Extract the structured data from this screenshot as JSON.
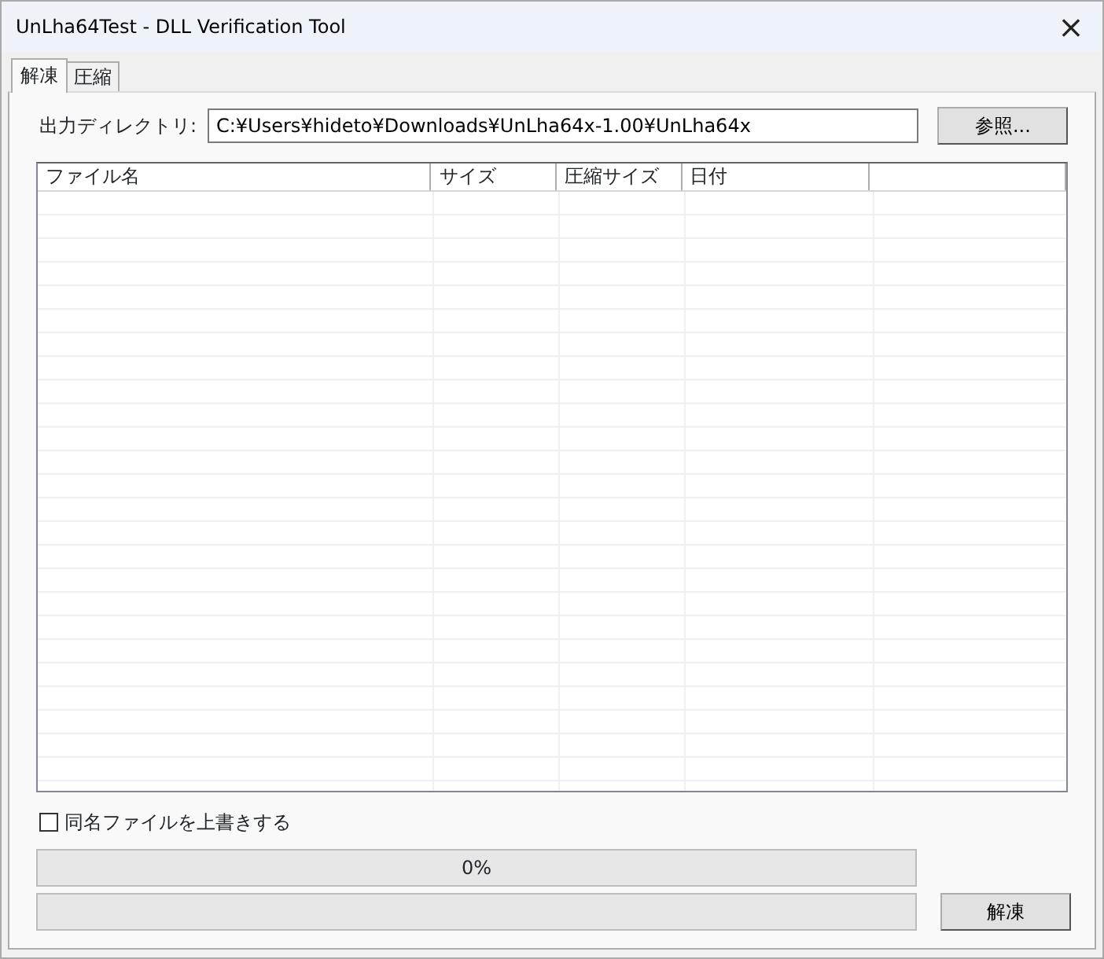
{
  "window": {
    "title": "UnLha64Test - DLL Verification Tool",
    "close": "×"
  },
  "tabs": [
    {
      "label": "解凍",
      "selected": true
    },
    {
      "label": "圧縮",
      "selected": false
    }
  ],
  "output_dir": {
    "label": "出力ディレクトリ:",
    "value": "C:¥Users¥hideto¥Downloads¥UnLha64x-1.00¥UnLha64x"
  },
  "browse_button": "参照...",
  "file_list": {
    "columns": [
      "ファイル名",
      "サイズ",
      "圧縮サイズ",
      "日付"
    ]
  },
  "overwrite": {
    "label": "同名ファイルを上書きする",
    "checked": false
  },
  "progress": [
    {
      "level": 0,
      "text": "0%"
    },
    {
      "level": 0
    }
  ],
  "extract_button": "解凍"
}
